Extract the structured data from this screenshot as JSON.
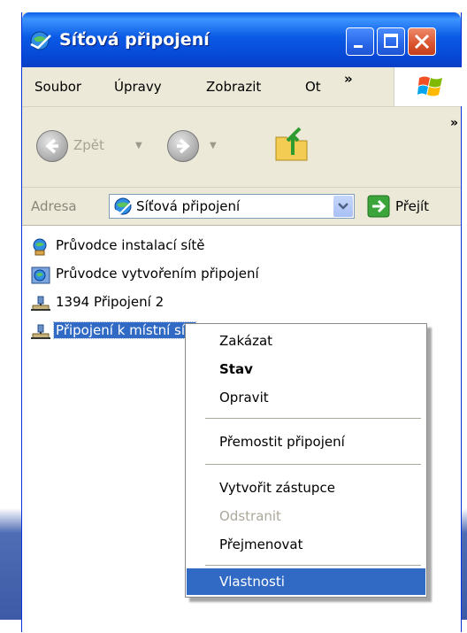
{
  "window": {
    "title": "Síťová připojení"
  },
  "menubar": {
    "items": [
      "Soubor",
      "Úpravy",
      "Zobrazit",
      "Ot"
    ],
    "more": "»"
  },
  "toolbar": {
    "back_label": "Zpět",
    "more": "»"
  },
  "address": {
    "label": "Adresa",
    "value": "Síťová připojení",
    "go_label": "Přejít"
  },
  "list": {
    "items": [
      {
        "label": "Průvodce instalací sítě",
        "icon": "network-setup-wizard-icon"
      },
      {
        "label": "Průvodce vytvořením připojení",
        "icon": "new-connection-wizard-icon"
      },
      {
        "label": "1394 Připojení 2",
        "icon": "network-connection-icon"
      },
      {
        "label": "Připojení k místní síti",
        "icon": "network-connection-icon",
        "selected": true
      }
    ]
  },
  "context_menu": {
    "items": [
      {
        "label": "Zakázat"
      },
      {
        "label": "Stav",
        "bold": true
      },
      {
        "label": "Opravit"
      },
      {
        "label": "Přemostit připojení"
      },
      {
        "label": "Vytvořit zástupce"
      },
      {
        "label": "Odstranit",
        "disabled": true
      },
      {
        "label": "Přejmenovat"
      },
      {
        "label": "Vlastnosti",
        "highlighted": true
      }
    ]
  },
  "colors": {
    "titlebar": "#0a5ae5",
    "selection": "#316ac5",
    "chrome": "#ece9d8"
  }
}
